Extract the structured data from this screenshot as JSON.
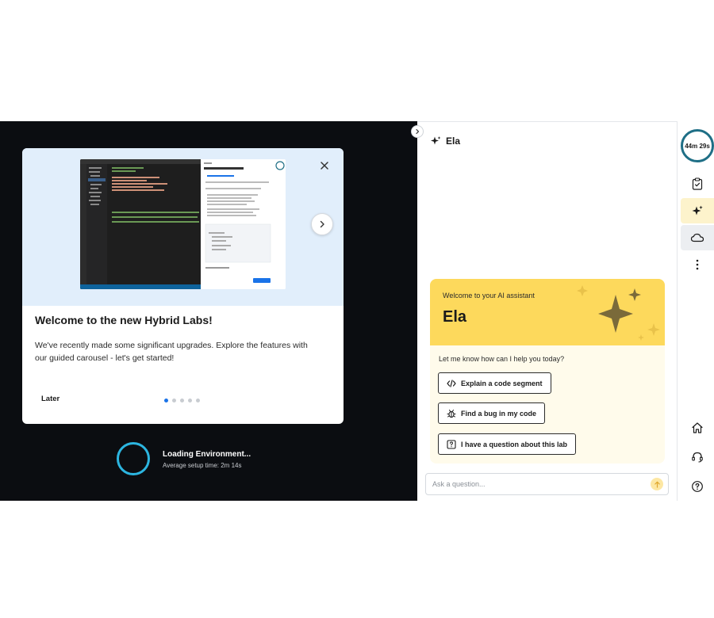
{
  "onboarding": {
    "title": "Welcome to the new Hybrid Labs!",
    "body": "We've recently made some significant upgrades. Explore the features with our guided carousel - let's get started!",
    "later_label": "Later",
    "total_slides": 5,
    "current_slide": 1
  },
  "loading": {
    "title": "Loading Environment...",
    "subtitle": "Average setup time: 2m 14s"
  },
  "assistant": {
    "name": "Ela",
    "welcome_kicker": "Welcome to your AI assistant",
    "welcome_name": "Ela",
    "prompt": "Let me know how can I help you today?",
    "actions": [
      {
        "label": "Explain a code segment",
        "icon": "code-icon"
      },
      {
        "label": "Find a bug in my code",
        "icon": "bug-icon"
      },
      {
        "label": "I have a question about this lab",
        "icon": "question-icon"
      }
    ],
    "ask_placeholder": "Ask a question..."
  },
  "rail": {
    "timer": "44m 29s",
    "items": [
      "clipboard-icon",
      "sparkle-icon",
      "cloud-icon",
      "more-icon",
      "home-icon",
      "headset-icon",
      "help-icon"
    ]
  },
  "colors": {
    "lab_background": "#0b0d11",
    "hero_background": "#e1eefb",
    "accent_blue": "#1a73e8",
    "spinner": "#2cb5e0",
    "ela_yellow": "#fdd95c",
    "timer_ring": "#1f6f86"
  }
}
